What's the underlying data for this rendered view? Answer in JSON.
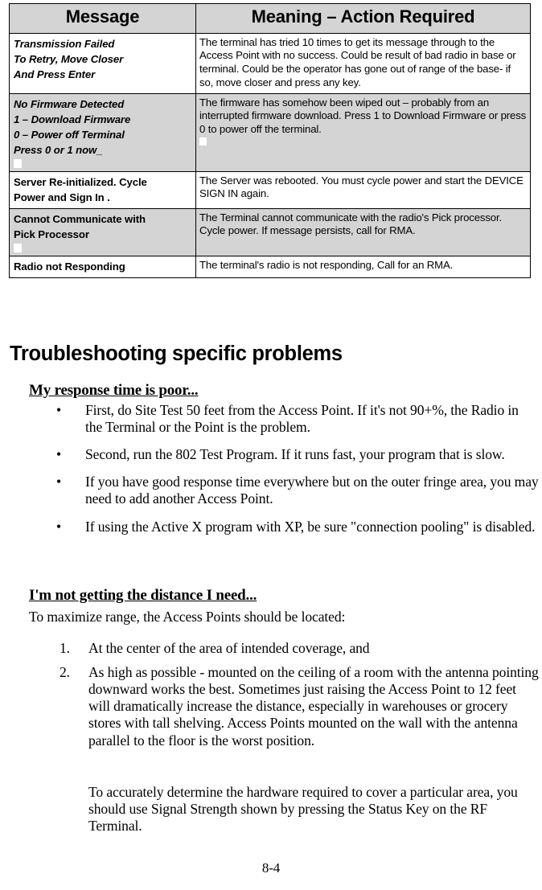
{
  "document": {
    "page_number": "8-4",
    "shading_color": "#d4d4d4",
    "text_color": "#000000",
    "background_color": "#ffffff"
  },
  "table": {
    "headers": {
      "message": "Message",
      "meaning": "Meaning – Action Required"
    },
    "rows": [
      {
        "shaded": false,
        "message_style": "italic",
        "message_lines": [
          "Transmission Failed",
          "To Retry, Move Closer",
          "And Press Enter"
        ],
        "meaning": "The terminal has tried 10 times to get its message through to the Access Point with no success. Could be result of bad radio in base or terminal. Could be the operator has gone out of range of the base- if so, move closer and press any key."
      },
      {
        "shaded": true,
        "message_style": "italic",
        "message_lines": [
          "No Firmware Detected",
          "1 – Download Firmware",
          "0 – Power off Terminal",
          "Press 0 or 1 now_"
        ],
        "meaning": "The firmware has somehow been wiped out – probably from an interrupted firmware download.  Press 1 to Download Firmware or press 0 to power off the terminal."
      },
      {
        "shaded": false,
        "message_style": "upright",
        "message_lines": [
          "Server Re-initialized. Cycle",
          "Power and Sign In ."
        ],
        "meaning": "The Server was rebooted. You must cycle power and start the DEVICE SIGN IN again."
      },
      {
        "shaded": true,
        "message_style": "upright",
        "message_lines": [
          "Cannot Communicate with",
          "Pick Processor"
        ],
        "meaning": "The Terminal cannot communicate with the radio's Pick processor. Cycle power. If message persists, call for RMA."
      },
      {
        "shaded": false,
        "message_style": "upright",
        "message_lines": [
          "Radio not Responding"
        ],
        "meaning": "The terminal's radio is not responding, Call for an RMA."
      }
    ]
  },
  "section": {
    "heading": "Troubleshooting specific problems",
    "subsection_response_time": {
      "heading": "My response time is poor...",
      "bullets": [
        "First, do Site Test 50 feet from the Access Point.  If it's not 90+%, the Radio in the Terminal or the Point is the problem.",
        "Second, run the 802 Test Program. If it runs fast, your program that is slow.",
        "If you have good response time everywhere but on the outer fringe area, you may need to add another Access Point.",
        "If using the Active X program with XP, be sure \"connection pooling\" is disabled."
      ],
      "bullet_glyph": "•"
    },
    "subsection_distance": {
      "heading": "I'm not getting the distance I need...",
      "lead_in": "To maximize range, the Access Points should be located:",
      "numbered_items": [
        {
          "marker": "1.",
          "text": "At the center of the area of intended coverage, and"
        },
        {
          "marker": "2.",
          "text": "As high as possible - mounted on the ceiling of a room with the antenna pointing downward works the best. Sometimes just raising the Access Point to 12 feet will dramatically increase the distance, especially in warehouses or grocery stores with tall shelving. Access Points  mounted on the wall with the antenna parallel to the floor is the worst position."
        }
      ],
      "closing_paragraph": "To accurately determine the hardware required to cover a particular area, you should use Signal Strength shown by pressing the Status Key on the RF Terminal."
    }
  }
}
